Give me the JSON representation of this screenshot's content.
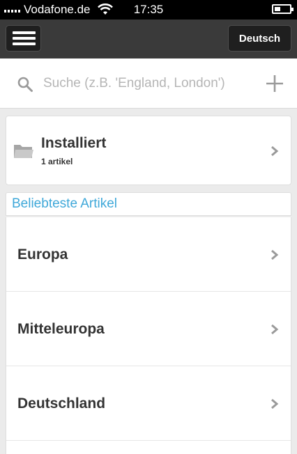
{
  "status_bar": {
    "carrier": "Vodafone.de",
    "time": "17:35",
    "battery_level": 0.4
  },
  "nav_bar": {
    "menu_icon": "hamburger-menu-icon",
    "language_label": "Deutsch"
  },
  "search": {
    "placeholder": "Suche (z.B. 'England, London')",
    "value": "",
    "search_icon": "search-icon",
    "add_icon": "plus-icon"
  },
  "installed": {
    "icon": "folder-icon",
    "title": "Installiert",
    "count_label": "1 artikel"
  },
  "popular": {
    "header": "Beliebteste Artikel",
    "accent_color": "#3fa8d9",
    "items": [
      {
        "label": "Europa"
      },
      {
        "label": "Mitteleuropa"
      },
      {
        "label": "Deutschland"
      }
    ]
  }
}
